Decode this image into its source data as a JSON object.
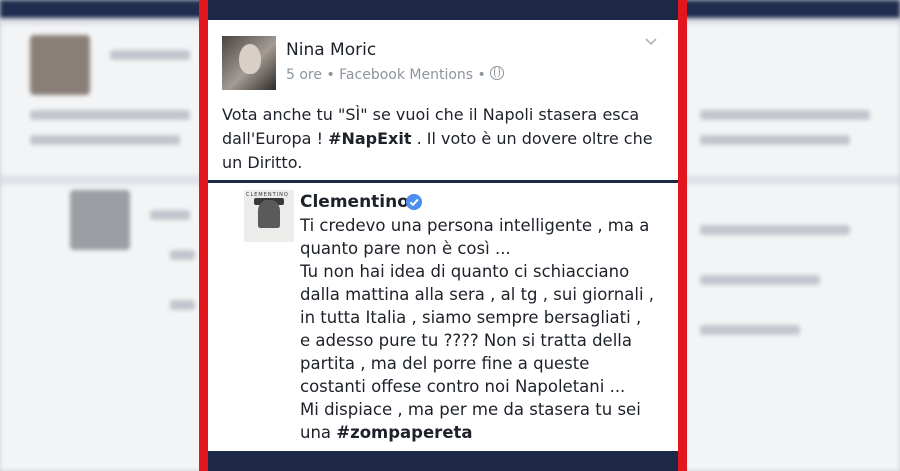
{
  "post": {
    "author": "Nina Moric",
    "time": "5 ore",
    "separator": "•",
    "via": "Facebook Mentions",
    "privacy_icon": "globe-icon",
    "text_part1": "Vota anche tu \"SÌ\" se vuoi che il Napoli stasera esca dall'Europa ! ",
    "hashtag": "#NapExit",
    "text_part2": " . Il voto è un dovere oltre che un Diritto."
  },
  "comment": {
    "author": "Clementino",
    "verified_icon": "verified-badge-icon",
    "avatar_title": "CLEMENTINO",
    "lines": [
      "Ti credevo una persona intelligente , ma a",
      "quanto pare non è così ...",
      "Tu non hai idea di quanto ci schiacciano",
      "dalla mattina alla sera , al tg , sui giornali ,",
      "in tutta Italia , siamo sempre bersagliati ,",
      "e adesso pure tu ???? Non si tratta della",
      "partita , ma del porre fine a queste",
      "costanti offese contro noi Napoletani ...",
      "Mi dispiace , ma per me da stasera tu sei"
    ],
    "last_prefix": "una ",
    "hashtag": "#zompapereta"
  },
  "colors": {
    "frame": "#e3151d",
    "navbar": "#1d2846",
    "verified": "#4d8ef0",
    "meta_text": "#8d949e"
  }
}
